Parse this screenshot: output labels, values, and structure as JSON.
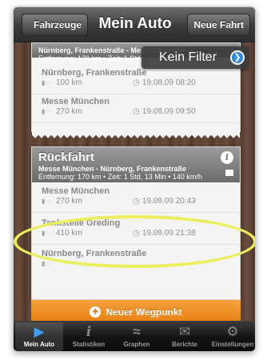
{
  "navbar": {
    "back_label": "Fahrzeuge",
    "title": "Mein Auto",
    "right_label": "Neue Fahrt"
  },
  "filter": {
    "label": "Kein Filter"
  },
  "trip_top": {
    "route": "Nürnberg, Frankenstraße - Messe München",
    "info": "Entfernung: 170 km • Zeit: 1 Std",
    "stops": [
      {
        "name": "Nürnberg, Frankenstraße",
        "distance": "100 km",
        "time": "19.08.09 08:20"
      },
      {
        "name": "Messe München",
        "distance": "270 km",
        "time": "19.08.09 09:50"
      }
    ]
  },
  "trip_bottom": {
    "title": "Rückfahrt",
    "route": "Messe München - Nürnberg, Frankenstraße",
    "info": "Entfernung: 170 km • Zeit: 1 Std, 13 Min • 140 km/h",
    "stops": [
      {
        "name": "Messe München",
        "distance": "270 km",
        "time": "19.08.09 20:43"
      },
      {
        "name": "Tankstelle Greding",
        "distance": "410 km",
        "time": "19.08.09 21:38"
      },
      {
        "name": "Nürnberg, Frankenstraße",
        "distance": "",
        "time": ""
      }
    ]
  },
  "action": {
    "label": "Neuer Wegpunkt"
  },
  "tabs": [
    {
      "label": "Mein Auto",
      "icon": "car-icon"
    },
    {
      "label": "Statistiken",
      "icon": "info-icon"
    },
    {
      "label": "Graphen",
      "icon": "graph-icon"
    },
    {
      "label": "Berichte",
      "icon": "mail-icon"
    },
    {
      "label": "Einstellungen",
      "icon": "gear-icon"
    }
  ],
  "colors": {
    "accent": "#e88a1a",
    "highlight": "#ecee5e",
    "tab_active": "#3a9cf2"
  }
}
